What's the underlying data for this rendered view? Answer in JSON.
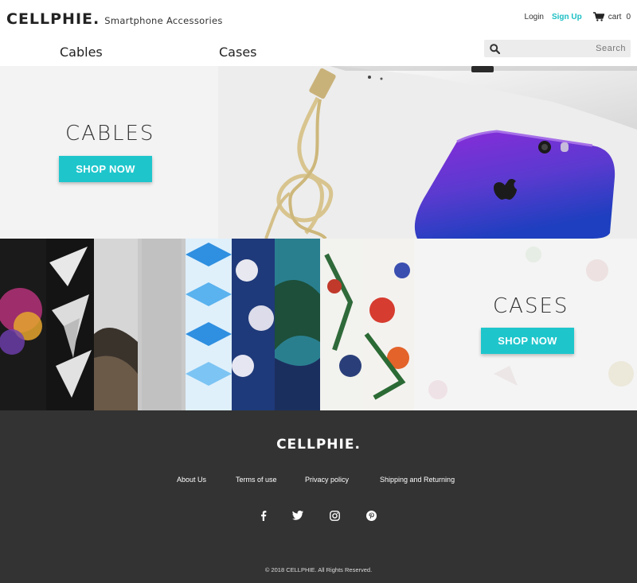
{
  "header": {
    "brand_name": "CELLPHIE.",
    "tagline": "Smartphone Accessories",
    "login": "Login",
    "signup": "Sign Up",
    "cart_label": "cart",
    "cart_count": "0",
    "accent_color": "#1bbfc4"
  },
  "nav": {
    "items": [
      {
        "label": "Cables"
      },
      {
        "label": "Cases"
      }
    ]
  },
  "search": {
    "placeholder": "Search",
    "icon": "search-icon"
  },
  "hero": {
    "cables": {
      "title": "CABLES",
      "button": "SHOP NOW"
    },
    "cases": {
      "title": "CASES",
      "button": "SHOP NOW"
    },
    "button_color": "#1ec6cc"
  },
  "footer": {
    "logo": "CELLPHIE.",
    "links": [
      "About Us",
      "Terms of use",
      "Privacy policy",
      "Shipping and Returning"
    ],
    "social": [
      "facebook-icon",
      "twitter-icon",
      "instagram-icon",
      "pinterest-icon"
    ],
    "copyright": "©  2018 CELLPHIE. All Rights Reserved.",
    "background": "#333333"
  }
}
